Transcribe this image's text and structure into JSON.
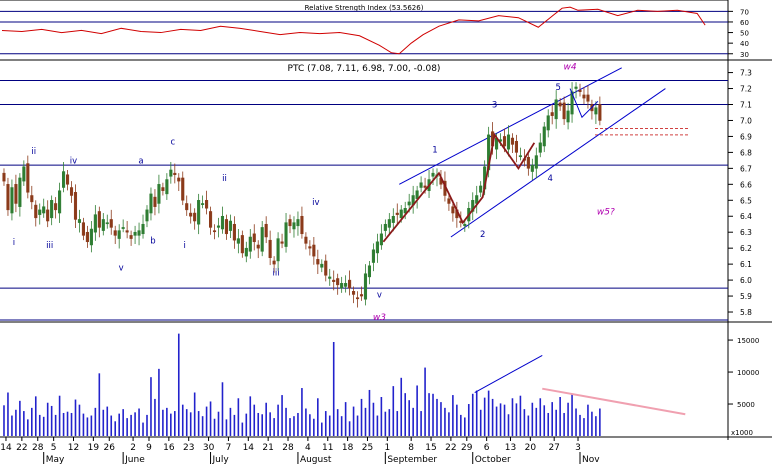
{
  "colors": {
    "background": "#ffffff",
    "grid": "#000080",
    "rsi_line": "#d00000",
    "candle_up": "#2e7d32",
    "candle_down": "#8b3a1a",
    "volume_bar": "#2222cc",
    "trend_channel": "#0000cc",
    "wave_line": "#8b1a1a",
    "dashed_level": "#d04040",
    "volume_trend_down": "#f0a0b0",
    "wave_label": "#000099",
    "wave_label_major": "#b000b0"
  },
  "chart_data": [
    {
      "panel": "rsi",
      "type": "line",
      "title": "Relative Strength Index (53.5626)",
      "y_ticks": [
        "70",
        "60",
        "50",
        "40",
        "30"
      ],
      "ylim": [
        26,
        76
      ],
      "levels": [
        70,
        60,
        30
      ],
      "x_range": [
        0,
        182
      ],
      "x": [
        0,
        5,
        10,
        15,
        20,
        25,
        30,
        35,
        40,
        45,
        50,
        55,
        60,
        65,
        70,
        75,
        80,
        85,
        90,
        95,
        98,
        100,
        103,
        106,
        110,
        115,
        120,
        125,
        130,
        135,
        139,
        141,
        143,
        145,
        150,
        155,
        160,
        165,
        170,
        175,
        177
      ],
      "values": [
        52,
        51,
        53,
        50,
        52,
        49,
        54,
        51,
        50,
        53,
        52,
        56,
        54,
        51,
        48,
        50,
        49,
        50,
        47,
        38,
        31,
        30,
        40,
        48,
        56,
        62,
        61,
        66,
        64,
        55,
        67,
        73,
        74,
        71,
        72,
        66,
        71,
        70,
        71,
        68,
        57
      ]
    },
    {
      "panel": "price",
      "type": "candlestick",
      "title": "PTC (7.08, 7.11, 6.98, 7.00, -0.08)",
      "y_ticks": [
        "7.3",
        "7.2",
        "7.1",
        "7.0",
        "6.9",
        "6.8",
        "6.7",
        "6.6",
        "6.5",
        "6.4",
        "6.3",
        "6.2",
        "6.1",
        "6.0",
        "5.9",
        "5.8"
      ],
      "ylim": [
        5.75,
        7.36
      ],
      "horizontal_levels": [
        7.25,
        7.1,
        6.72,
        5.95,
        5.75
      ],
      "dashed_levels": [
        6.95,
        6.91
      ],
      "x_range": [
        0,
        182
      ],
      "close": [
        6.62,
        6.44,
        6.58,
        6.48,
        6.64,
        6.71,
        6.55,
        6.49,
        6.39,
        6.44,
        6.46,
        6.37,
        6.5,
        6.44,
        6.56,
        6.68,
        6.6,
        6.53,
        6.38,
        6.38,
        6.28,
        6.24,
        6.32,
        6.41,
        6.33,
        6.38,
        6.36,
        6.33,
        6.28,
        6.31,
        6.33,
        6.3,
        6.26,
        6.3,
        6.31,
        6.35,
        6.44,
        6.54,
        6.46,
        6.6,
        6.56,
        6.63,
        6.69,
        6.66,
        6.62,
        6.5,
        6.44,
        6.4,
        6.37,
        6.5,
        6.48,
        6.45,
        6.33,
        6.31,
        6.34,
        6.4,
        6.29,
        6.37,
        6.25,
        6.26,
        6.17,
        6.2,
        6.27,
        6.24,
        6.2,
        6.33,
        6.27,
        6.14,
        6.1,
        6.26,
        6.23,
        6.36,
        6.34,
        6.36,
        6.38,
        6.29,
        6.23,
        6.2,
        6.15,
        6.1,
        6.1,
        6.03,
        6.02,
        5.99,
        5.97,
        5.98,
        5.98,
        5.95,
        5.91,
        5.89,
        5.9,
        6.04,
        6.09,
        6.19,
        6.24,
        6.29,
        6.35,
        6.38,
        6.4,
        6.41,
        6.44,
        6.45,
        6.49,
        6.53,
        6.56,
        6.61,
        6.58,
        6.63,
        6.67,
        6.66,
        6.6,
        6.53,
        6.48,
        6.42,
        6.39,
        6.36,
        6.35,
        6.45,
        6.5,
        6.53,
        6.59,
        6.71,
        6.91,
        6.84,
        6.89,
        6.88,
        6.84,
        6.91,
        6.85,
        6.8,
        6.78,
        6.75,
        6.7,
        6.72,
        6.78,
        6.86,
        6.96,
        7.03,
        7.03,
        7.13,
        7.09,
        7.01,
        7.06,
        7.18,
        7.21,
        7.18,
        7.14,
        7.12,
        7.06,
        7.08,
        7.0
      ],
      "wave_labels": [
        {
          "text": "ii",
          "x": 8,
          "price": 6.79,
          "major": false
        },
        {
          "text": "i",
          "x": 3,
          "price": 6.22,
          "major": false
        },
        {
          "text": "iii",
          "x": 12,
          "price": 6.2,
          "major": false
        },
        {
          "text": "iv",
          "x": 18,
          "price": 6.73,
          "major": false
        },
        {
          "text": "v",
          "x": 30,
          "price": 6.06,
          "major": false
        },
        {
          "text": "a",
          "x": 35,
          "price": 6.73,
          "major": false
        },
        {
          "text": "b",
          "x": 38,
          "price": 6.23,
          "major": false
        },
        {
          "text": "c",
          "x": 43,
          "price": 6.85,
          "major": false
        },
        {
          "text": "i",
          "x": 46,
          "price": 6.2,
          "major": false
        },
        {
          "text": "ii",
          "x": 56,
          "price": 6.62,
          "major": false
        },
        {
          "text": "iii",
          "x": 69,
          "price": 6.03,
          "major": false
        },
        {
          "text": "iv",
          "x": 79,
          "price": 6.47,
          "major": false
        },
        {
          "text": "v",
          "x": 95,
          "price": 5.89,
          "major": false
        },
        {
          "text": "w3",
          "x": 95,
          "price": 5.75,
          "major": true
        },
        {
          "text": "1",
          "x": 109,
          "price": 6.8,
          "major": false
        },
        {
          "text": "2",
          "x": 121,
          "price": 6.27,
          "major": false
        },
        {
          "text": "3",
          "x": 124,
          "price": 7.08,
          "major": false
        },
        {
          "text": "4",
          "x": 138,
          "price": 6.62,
          "major": false
        },
        {
          "text": "5",
          "x": 140,
          "price": 7.19,
          "major": false
        },
        {
          "text": "w4",
          "x": 143,
          "price": 7.32,
          "major": true
        },
        {
          "text": "w5?",
          "x": 152,
          "price": 6.41,
          "major": true
        }
      ]
    },
    {
      "panel": "volume",
      "type": "bar",
      "y_ticks": [
        "15000",
        "10000",
        "5000"
      ],
      "unit_label": "x1000",
      "ylim": [
        0,
        17200
      ],
      "x_range": [
        0,
        182
      ],
      "values": [
        4800,
        6800,
        3200,
        4100,
        5500,
        3900,
        2600,
        4400,
        6200,
        3300,
        3000,
        5200,
        4700,
        3300,
        6300,
        3600,
        3800,
        3600,
        5700,
        4900,
        3500,
        2900,
        3200,
        4400,
        9800,
        4100,
        4600,
        3200,
        2300,
        3500,
        4200,
        2800,
        3300,
        3700,
        4300,
        2100,
        3300,
        9200,
        5800,
        10500,
        4100,
        4400,
        3500,
        3900,
        16000,
        4900,
        4200,
        3700,
        6800,
        3900,
        3100,
        4600,
        5400,
        2700,
        3800,
        8400,
        2600,
        4400,
        3300,
        5900,
        2100,
        3500,
        6200,
        4900,
        3600,
        3400,
        5200,
        3700,
        2800,
        4900,
        6400,
        4400,
        2800,
        3100,
        3600,
        7500,
        4300,
        3400,
        2700,
        5900,
        2100,
        3900,
        3200,
        14700,
        4200,
        3100,
        5300,
        2300,
        4600,
        3200,
        5800,
        4400,
        7200,
        5200,
        3200,
        6100,
        3800,
        4200,
        7800,
        3900,
        9100,
        6700,
        5600,
        4400,
        7900,
        3900,
        10700,
        6700,
        6600,
        5800,
        5300,
        4400,
        3700,
        6400,
        4900,
        3300,
        2900,
        5000,
        6600,
        7100,
        4100,
        6000,
        7100,
        5800,
        4600,
        5100,
        4900,
        3400,
        5900,
        5100,
        6300,
        4200,
        3200,
        5200,
        4400,
        5900,
        4800,
        3600,
        5300,
        4100,
        6100,
        3600,
        5200,
        6600,
        4300,
        3300,
        2800,
        4900,
        3800,
        3100,
        4300
      ]
    }
  ],
  "x_axis": {
    "date_labels": [
      "14",
      "22",
      "28",
      "5",
      "12",
      "19",
      "26",
      "2",
      "9",
      "16",
      "23",
      "30",
      "7",
      "14",
      "21",
      "28",
      "4",
      "11",
      "18",
      "25",
      "1",
      "8",
      "15",
      "22",
      "29",
      "6",
      "13",
      "20",
      "27",
      "3"
    ],
    "date_label_x": [
      1,
      5,
      9,
      13,
      18,
      23,
      27,
      33,
      37,
      42,
      47,
      52,
      57,
      62,
      67,
      72,
      77,
      82,
      87,
      92,
      97,
      103,
      108,
      113,
      117,
      122,
      128,
      133,
      139,
      145
    ],
    "month_labels": [
      "May",
      "June",
      "July",
      "August",
      "September",
      "October",
      "Nov"
    ],
    "month_label_x": [
      11,
      31,
      53,
      75,
      97,
      119,
      146
    ]
  }
}
